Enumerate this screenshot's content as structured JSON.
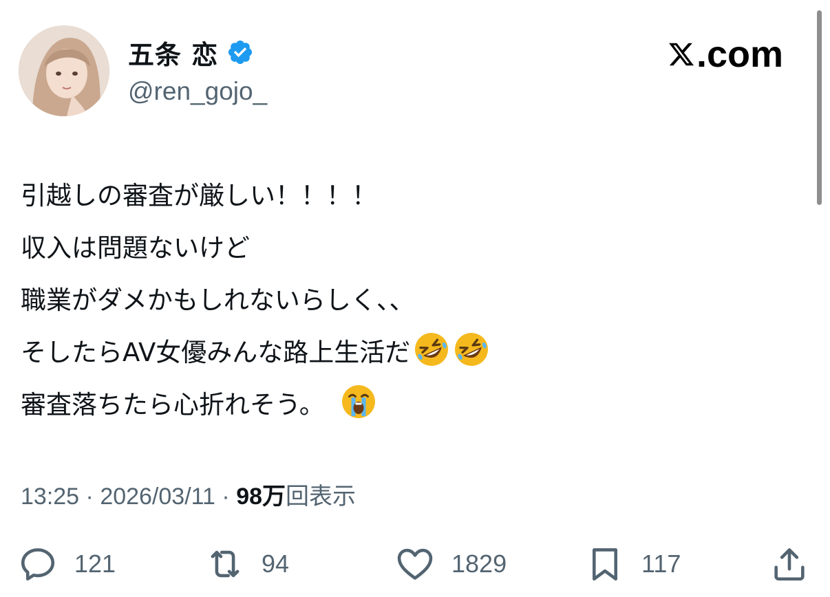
{
  "author": {
    "display_name": "五条 恋",
    "handle": "@ren_gojo_",
    "verified": true
  },
  "brand": {
    "text": ".com",
    "logo_icon": "x-logo-icon"
  },
  "tweet": {
    "lines": [
      "引越しの審査が厳しい！！！！",
      "収入は問題ないけど",
      "職業がダメかもしれないらしく、、",
      "そしたらAV女優みんな路上生活だ",
      "審査落ちたら心折れそう。"
    ],
    "line4_emojis": [
      "rolling-on-floor-laughing-emoji",
      "rolling-on-floor-laughing-emoji"
    ],
    "line5_emoji": "loudly-crying-emoji"
  },
  "meta": {
    "time": "13:25",
    "separator": " · ",
    "date": "2026/03/11",
    "views_count": "98万",
    "views_label": "回表示"
  },
  "actions": {
    "replies": "121",
    "reposts": "94",
    "likes": "1829",
    "bookmarks": "117"
  },
  "colors": {
    "text_primary": "#0f1419",
    "text_secondary": "#536471",
    "verified_blue": "#1d9bf0"
  }
}
